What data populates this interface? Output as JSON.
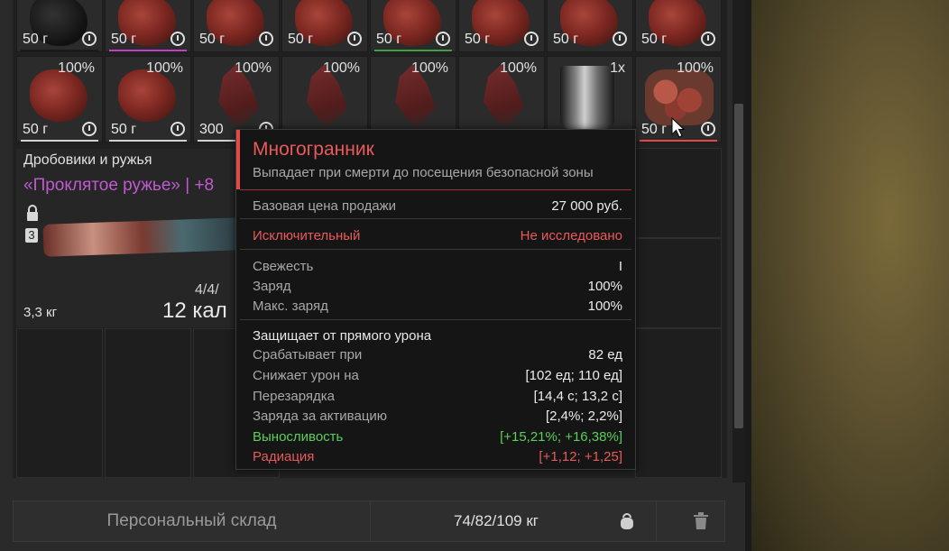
{
  "inventory": {
    "row1": [
      {
        "weight": "50 г",
        "line": "#1a1a1a"
      },
      {
        "weight": "50 г",
        "line": "#c040c0"
      },
      {
        "weight": "50 г",
        "line": "#1a1a1a"
      },
      {
        "weight": "50 г",
        "line": "#1a1a1a"
      },
      {
        "weight": "50 г",
        "line": "#40a040"
      },
      {
        "weight": "50 г",
        "line": "#1a1a1a"
      },
      {
        "weight": "50 г",
        "line": "#1a1a1a"
      },
      {
        "weight": "50 г",
        "line": "#1a1a1a"
      }
    ],
    "row2": [
      {
        "pct": "100%",
        "weight": "50 г",
        "line": "#d0d0d0",
        "art": "meat"
      },
      {
        "pct": "100%",
        "weight": "50 г",
        "line": "#d0d0d0",
        "art": "meat"
      },
      {
        "pct": "100%",
        "weight": "300",
        "line": "#d0d0d0",
        "art": "feather"
      },
      {
        "pct": "100%",
        "weight": "",
        "line": "#d0d0d0",
        "art": "feather"
      },
      {
        "pct": "100%",
        "weight": "",
        "line": "#d0d0d0",
        "art": "feather"
      },
      {
        "pct": "100%",
        "weight": "",
        "line": "#d0d0d0",
        "art": "feather"
      },
      {
        "pct": "1x",
        "weight": "",
        "line": "#d0d0d0",
        "art": "pot"
      },
      {
        "pct": "100%",
        "weight": "50 г",
        "line": "#e24a4a",
        "art": "moss"
      }
    ]
  },
  "weapon": {
    "category": "Дробовики и ружья",
    "name": "«Проклятое ружье» | +8",
    "level": "3",
    "weight": "3,3 кг",
    "ammo": "4/4/",
    "caliber": "12 кал"
  },
  "tooltip": {
    "title": "Многогранник",
    "subtitle": "Выпадает при смерти до посещения безопасной зоны",
    "base_price_label": "Базовая цена продажи",
    "base_price_value": "27 000 руб.",
    "rarity_label": "Исключительный",
    "research_value": "Не исследовано",
    "freshness_label": "Свежесть",
    "freshness_value": "I",
    "charge_label": "Заряд",
    "charge_value": "100%",
    "max_charge_label": "Макс. заряд",
    "max_charge_value": "100%",
    "section_header": "Защищает от прямого урона",
    "trigger_label": "Срабатывает при",
    "trigger_value": "82 ед",
    "reduce_label": "Снижает урон на",
    "reduce_value": "[102 ед; 110 ед]",
    "recharge_label": "Перезарядка",
    "recharge_value": "[14,4 с; 13,2 с]",
    "per_activation_label": "Заряда за активацию",
    "per_activation_value": "[2,4%; 2,2%]",
    "stamina_label": "Выносливость",
    "stamina_value": "[+15,21%; +16,38%]",
    "radiation_label": "Радиация",
    "radiation_value": "[+1,12; +1,25]"
  },
  "footer": {
    "storage_label": "Персональный склад",
    "weight_label": "74/82/109 кг"
  },
  "colors": {
    "rarity_red": "#e85a5a",
    "legendary_purple": "#c05ad0",
    "positive_green": "#5ad05a"
  }
}
